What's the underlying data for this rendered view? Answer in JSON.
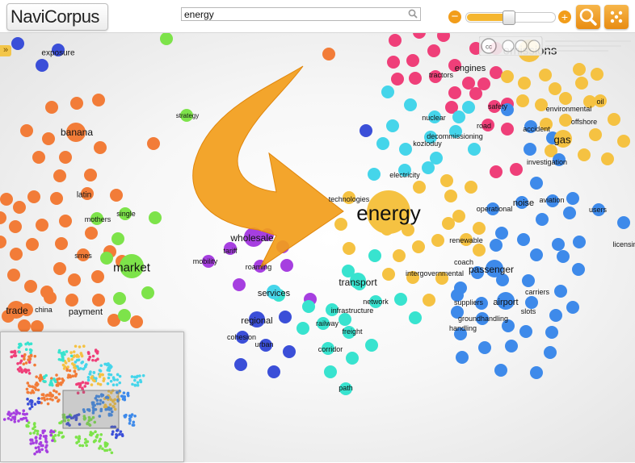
{
  "app": {
    "title": "NaviCorpus"
  },
  "search": {
    "value": "energy"
  },
  "zoom": {
    "level": 0.48,
    "out_label": "−",
    "in_label": "+"
  },
  "colors": {
    "accent": "#f29d1a",
    "orange": "#f27c38",
    "green": "#7de34a",
    "yellow": "#f5c242",
    "pink": "#ef3f79",
    "cyan": "#45d5ea",
    "teal": "#38e3cf",
    "blue": "#3e8aea",
    "indigo": "#3b4fd8",
    "purple": "#a63fe0"
  },
  "focus_word": "energy",
  "word_labels": [
    "exposure",
    "banana",
    "latin",
    "mothers",
    "single",
    "smes",
    "market",
    "trade",
    "china",
    "payment",
    "strategy",
    "wholesale",
    "tariff",
    "mobility",
    "roaming",
    "services",
    "regional",
    "cohesion",
    "urban",
    "technologies",
    "energy",
    "transport",
    "infrastructure",
    "network",
    "railway",
    "freight",
    "corridor",
    "path",
    "intergovernmental",
    "electricity",
    "nuclear",
    "decommissioning",
    "kozloduy",
    "road",
    "safety",
    "engines",
    "tractors",
    "emissions",
    "environmental",
    "oil",
    "offshore",
    "accident",
    "gas",
    "investigation",
    "noise",
    "aviation",
    "users",
    "operational",
    "renewable",
    "coach",
    "passenger",
    "carriers",
    "airport",
    "suppliers",
    "slots",
    "groundhandling",
    "handling",
    "licensing"
  ],
  "minimap": {
    "viewport_label": ""
  },
  "license": {
    "badge": "cc"
  }
}
